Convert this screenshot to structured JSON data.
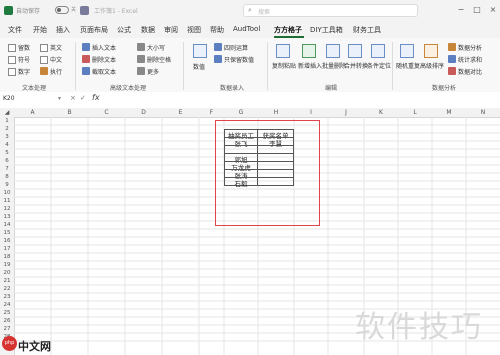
{
  "titlebar": {
    "autosave": "自动保存",
    "toggle": "关",
    "filename": "工作簿1 - Excel",
    "search_placeholder": "搜索"
  },
  "tabs": [
    "文件",
    "开始",
    "插入",
    "页面布局",
    "公式",
    "数据",
    "审阅",
    "视图",
    "帮助",
    "AudTool",
    "方方格子",
    "DIY工具箱",
    "财务工具"
  ],
  "active_tab": "方方格子",
  "ribbon": {
    "text_group": {
      "checks": [
        "留数",
        "英文",
        "符号",
        "中文",
        "数字",
        "执行"
      ],
      "label": "文本处理"
    },
    "adv_text_group": {
      "items": [
        "插入文本",
        "删除文本",
        "截取文本",
        "大小写",
        "删除空格",
        "更多"
      ],
      "label": "高级文本处理"
    },
    "data_entry_group": {
      "items": [
        "数值",
        "四则运算",
        "只保留数值"
      ],
      "label": "数据录入"
    },
    "edit_group": {
      "items": [
        "复制粘贴",
        "新增插入",
        "批量删除",
        "合并转换",
        "条件定位"
      ],
      "label": "编辑"
    },
    "analysis_group": {
      "items": [
        "随机重复",
        "高级排序",
        "数据分析",
        "统计求和",
        "数据对比"
      ],
      "label": "数据分析"
    }
  },
  "formula_bar": {
    "name_box": "K20",
    "fx": "fx"
  },
  "columns": [
    "A",
    "B",
    "C",
    "D",
    "E",
    "F",
    "G",
    "H",
    "I",
    "J",
    "K",
    "L",
    "M",
    "N"
  ],
  "rows": [
    "1",
    "2",
    "3",
    "4",
    "5",
    "6",
    "7",
    "8",
    "9",
    "10",
    "11",
    "12",
    "13",
    "14",
    "15",
    "16",
    "17",
    "18",
    "19",
    "20",
    "21",
    "22",
    "23",
    "24",
    "25",
    "26",
    "27",
    "28"
  ],
  "table": {
    "header": [
      "抽奖员工",
      "获奖名单"
    ],
    "rows": [
      [
        "张飞",
        "李慧"
      ],
      [
        "",
        ""
      ],
      [
        "郭旭",
        ""
      ],
      [
        "万龙虎",
        ""
      ],
      [
        "张涛",
        ""
      ],
      [
        "石毅",
        ""
      ]
    ]
  },
  "watermark": {
    "text": "软件技巧",
    "logo": "中文网",
    "logo_badge": "php"
  }
}
